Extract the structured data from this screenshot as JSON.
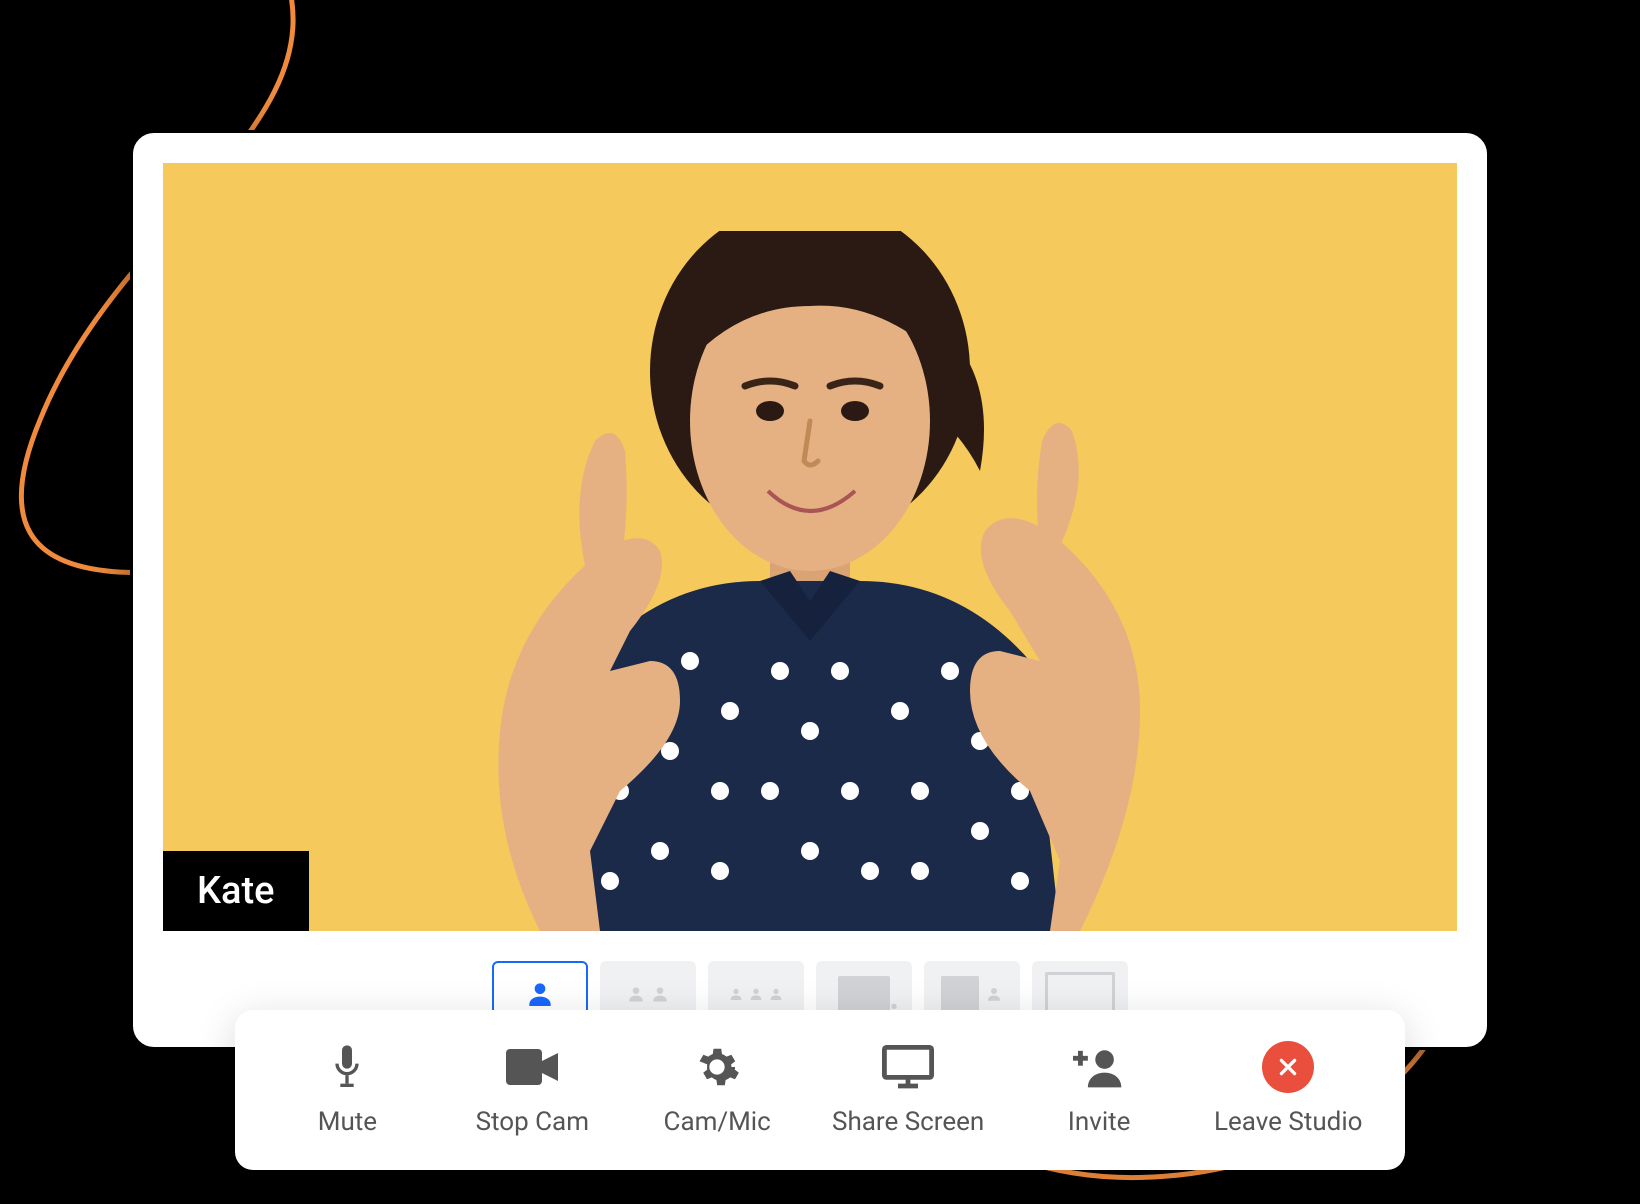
{
  "participant": {
    "name": "Kate"
  },
  "layouts": {
    "options": [
      "single",
      "two-up",
      "three-up",
      "picture-in-picture",
      "split",
      "full"
    ],
    "selected_index": 0
  },
  "toolbar": {
    "mute": {
      "label": "Mute",
      "icon": "mic-icon"
    },
    "camera": {
      "label": "Stop Cam",
      "icon": "video-icon"
    },
    "settings": {
      "label": "Cam/Mic",
      "icon": "gear-icon"
    },
    "share": {
      "label": "Share Screen",
      "icon": "monitor-icon"
    },
    "invite": {
      "label": "Invite",
      "icon": "add-user-icon"
    },
    "leave": {
      "label": "Leave Studio",
      "icon": "close-icon"
    }
  },
  "colors": {
    "video_bg": "#f5c95b",
    "accent": "#1868fb",
    "danger": "#e94f3c",
    "swirl": "#f08a3c"
  }
}
